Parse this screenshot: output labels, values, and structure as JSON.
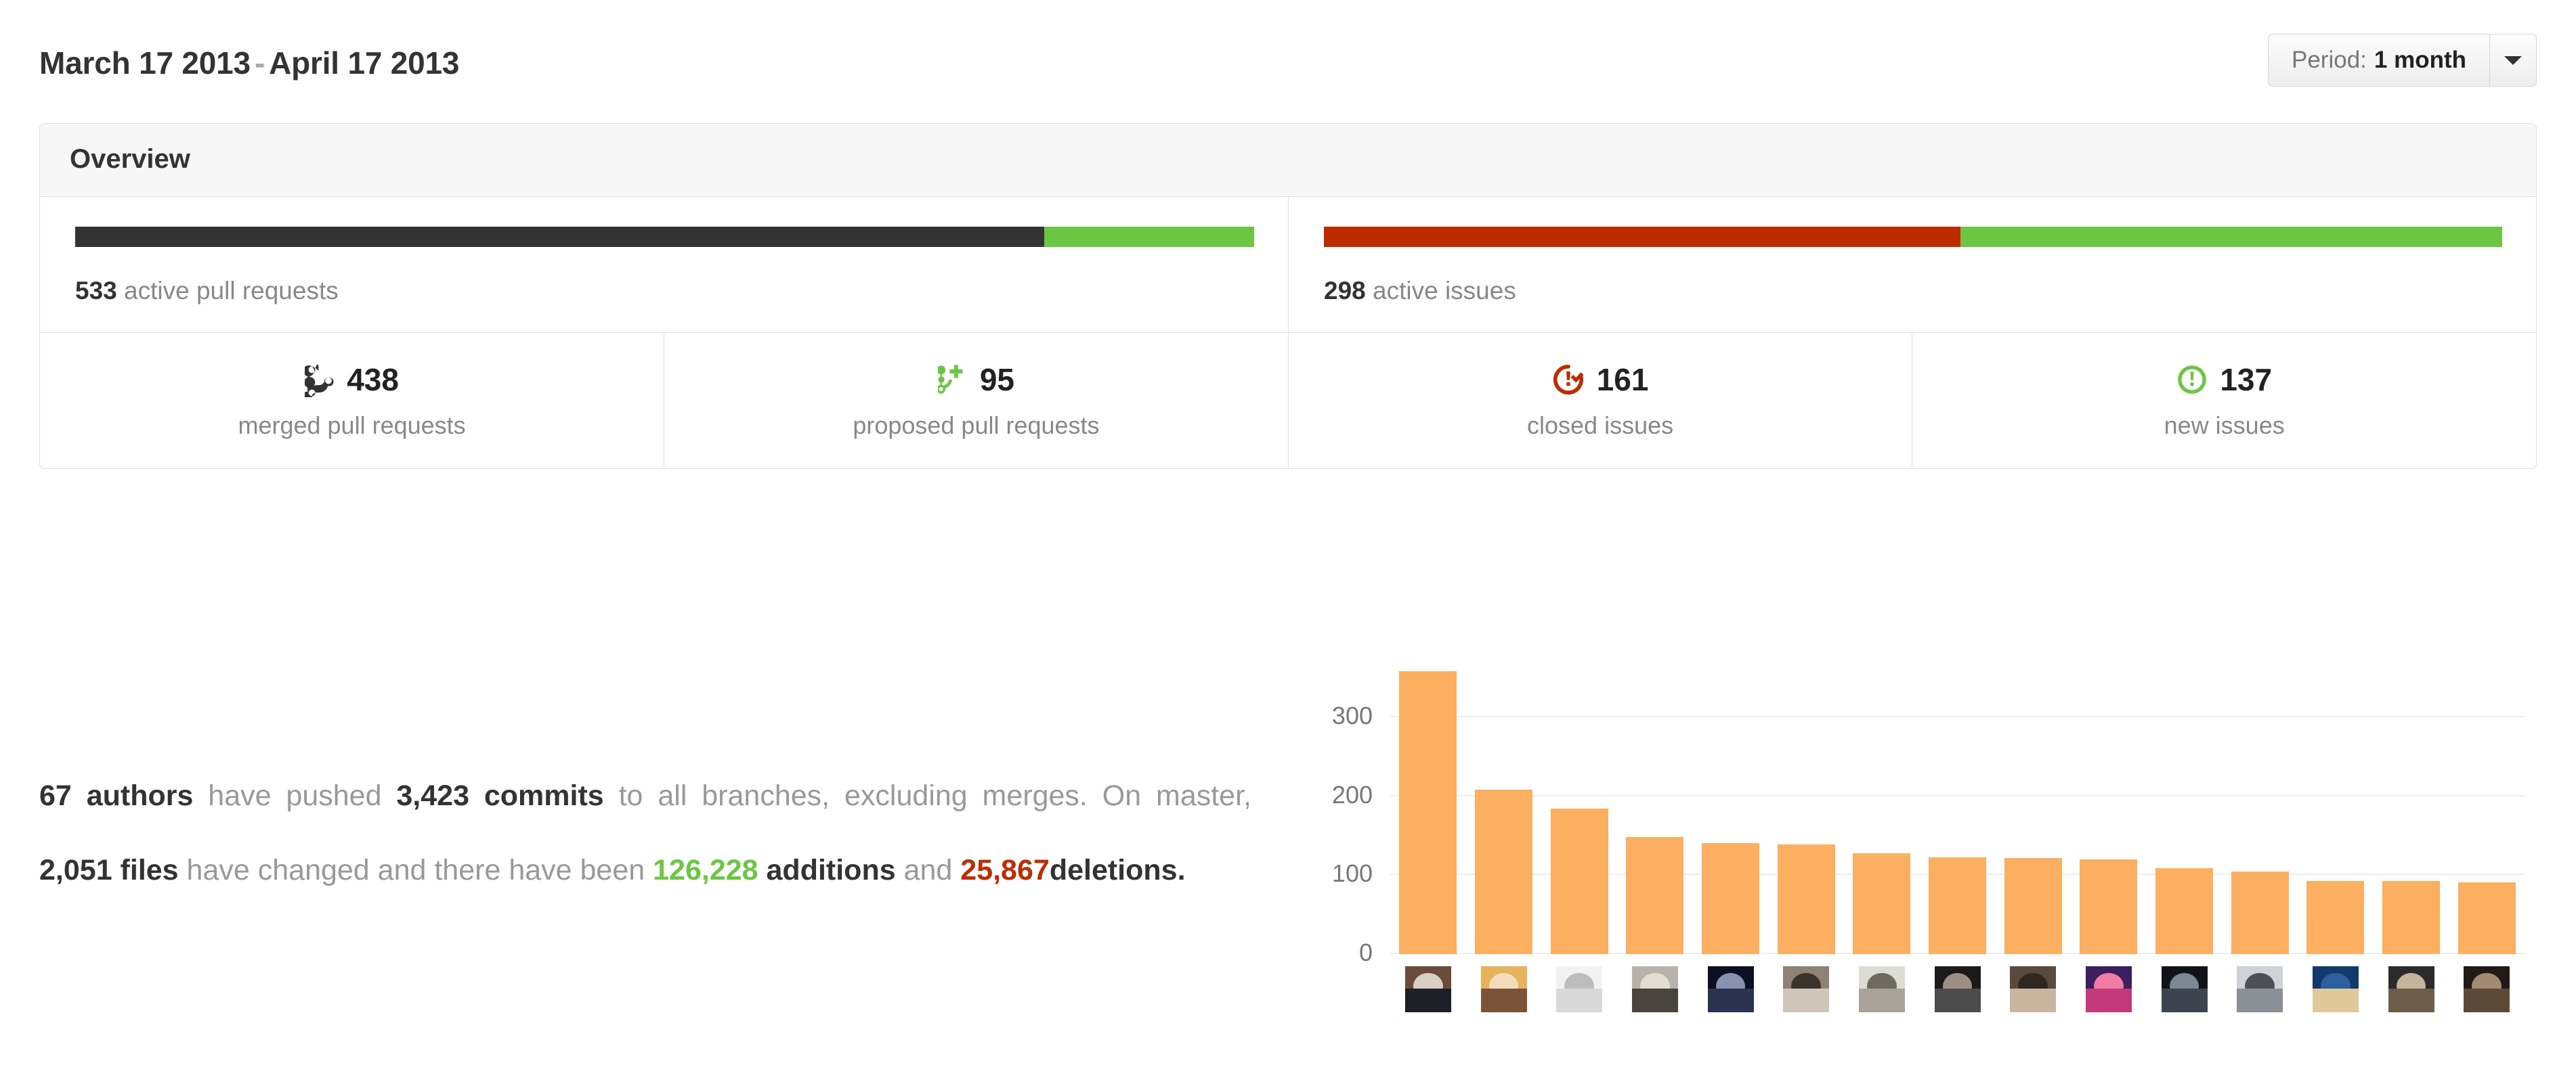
{
  "header": {
    "date_start": "March 17 2013",
    "date_separator": "-",
    "date_end": "April 17 2013",
    "period_label": "Period:",
    "period_value": "1 month",
    "caret_icon": "chevron-down-icon"
  },
  "overview": {
    "title": "Overview",
    "pull_requests": {
      "bar": {
        "segments": [
          {
            "name": "merged",
            "color": "#333333",
            "percent": 82.2
          },
          {
            "name": "proposed",
            "color": "#6cc644",
            "percent": 17.8
          }
        ]
      },
      "count": "533",
      "caption": "active pull requests",
      "stats": [
        {
          "icon": "git-merge-icon",
          "icon_color": "#333333",
          "value": "438",
          "label": "merged pull requests"
        },
        {
          "icon": "git-pull-request-plus-icon",
          "icon_color": "#6cc644",
          "value": "95",
          "label": "proposed pull requests"
        }
      ]
    },
    "issues": {
      "bar": {
        "segments": [
          {
            "name": "closed",
            "color": "#bd2c00",
            "percent": 54.0
          },
          {
            "name": "new",
            "color": "#6cc644",
            "percent": 46.0
          }
        ]
      },
      "count": "298",
      "caption": "active issues",
      "stats": [
        {
          "icon": "issue-closed-icon",
          "icon_color": "#bd2c00",
          "value": "161",
          "label": "closed issues"
        },
        {
          "icon": "issue-opened-icon",
          "icon_color": "#6cc644",
          "value": "137",
          "label": "new issues"
        }
      ]
    }
  },
  "summary": {
    "authors_count": "67 authors",
    "text_1": "have pushed",
    "commits_count": "3,423 commits",
    "text_2": "to all branches, excluding merges. On master,",
    "files_count": "2,051 files",
    "text_3": "have changed and there have been",
    "additions_count": "126,228",
    "additions_word": "additions",
    "text_4": "and",
    "deletions_count": "25,867",
    "deletions_word": "deletions",
    "text_5": "."
  },
  "chart_data": {
    "type": "bar",
    "title": "",
    "xlabel": "",
    "ylabel": "",
    "ylim": [
      0,
      360
    ],
    "yticks": [
      0,
      100,
      200,
      300
    ],
    "ytick_labels": [
      "0",
      "100",
      "200",
      "300"
    ],
    "grid": true,
    "bar_color": "#fcaf60",
    "legend": "none",
    "categories": [
      "author-1",
      "author-2",
      "author-3",
      "author-4",
      "author-5",
      "author-6",
      "author-7",
      "author-8",
      "author-9",
      "author-10",
      "author-11",
      "author-12",
      "author-13",
      "author-14",
      "author-15"
    ],
    "values": [
      358,
      208,
      184,
      148,
      141,
      139,
      128,
      123,
      122,
      120,
      109,
      105,
      93,
      93,
      91
    ],
    "xtick_images": "author avatar thumbnails"
  },
  "colors": {
    "green": "#6cc644",
    "red": "#bd2c00",
    "dark": "#333333",
    "orange": "#fcaf60",
    "muted": "#999999",
    "border": "#dddddd",
    "panel": "#f7f7f7"
  }
}
